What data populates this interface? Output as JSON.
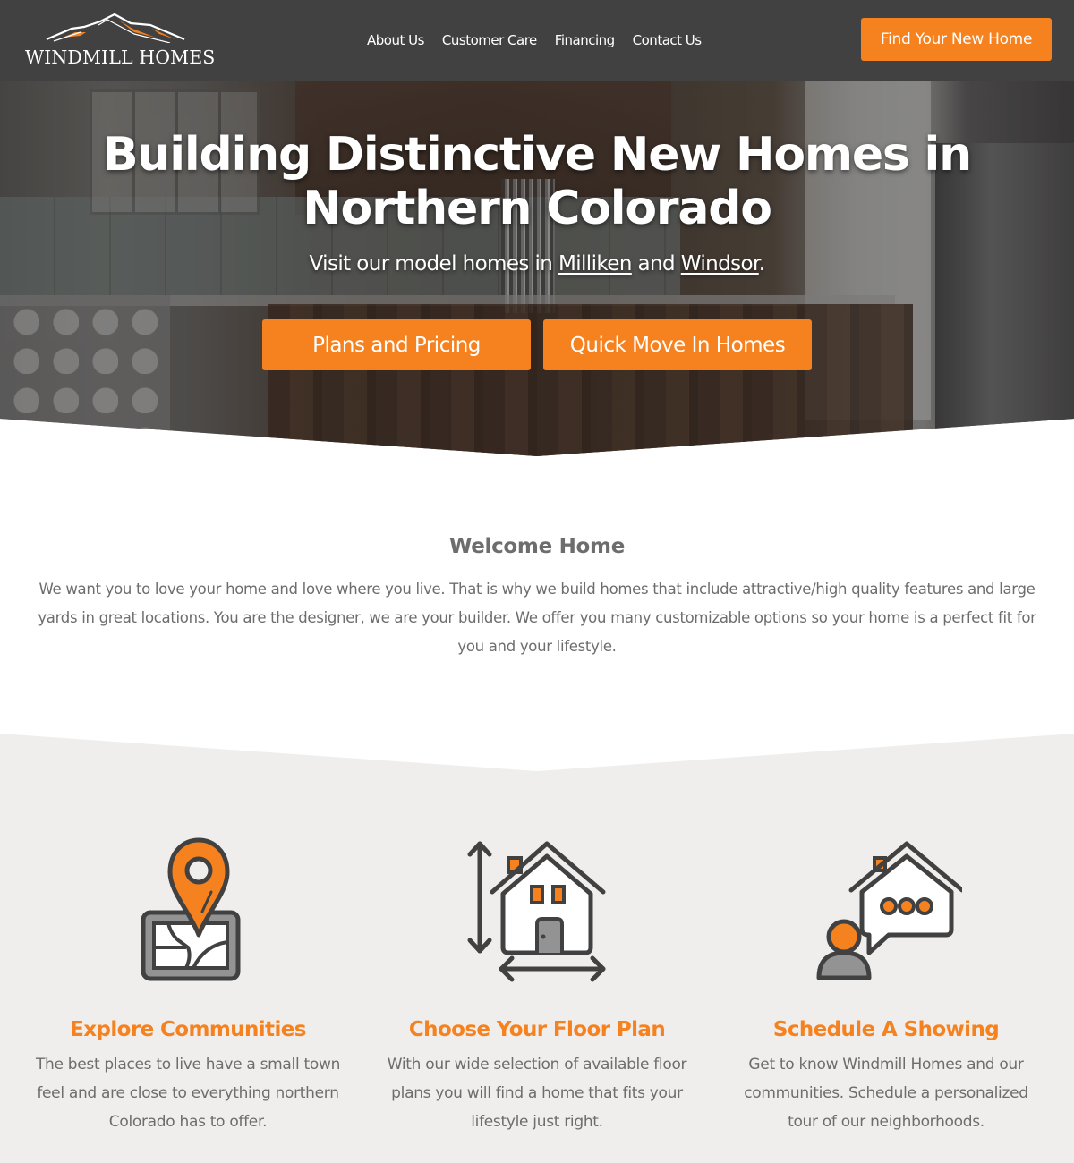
{
  "header": {
    "logo_text": "WINDMILL HOMES",
    "nav": [
      {
        "label": "About Us"
      },
      {
        "label": "Customer Care"
      },
      {
        "label": "Financing"
      },
      {
        "label": "Contact Us"
      }
    ],
    "cta_label": "Find Your New Home"
  },
  "hero": {
    "title_line1": "Building Distinctive New Homes in",
    "title_line2": "Northern Colorado",
    "subtitle_prefix": "Visit our model homes in ",
    "link_milliken": "Milliken",
    "subtitle_and": " and ",
    "link_windsor": "Windsor",
    "subtitle_suffix": ".",
    "buttons": [
      {
        "label": "Plans and Pricing"
      },
      {
        "label": "Quick Move In Homes"
      }
    ]
  },
  "welcome": {
    "title": "Welcome Home",
    "text": "We want you to love your home and love where you live. That is why we build homes that include attractive/high quality features and large yards in great locations. You are the designer, we are your builder. We offer you many customizable options so your home is a perfect fit for you and your lifestyle."
  },
  "features": [
    {
      "icon": "map-pin-icon",
      "title": "Explore Communities",
      "text": "The best places to live have a small town feel and are close to everything northern Colorado has to offer."
    },
    {
      "icon": "floor-plan-house-icon",
      "title": "Choose Your Floor Plan",
      "text": "With our wide selection of available floor plans you will find a home that fits your lifestyle just right."
    },
    {
      "icon": "schedule-showing-icon",
      "title": "Schedule A Showing",
      "text": "Get to know Windmill Homes and our communities. Schedule a personalized tour of our neighborhoods."
    }
  ],
  "colors": {
    "accent": "#f5821f",
    "header_bg": "#414142",
    "text": "#6d6d6d",
    "icon_stroke": "#414142",
    "features_bg": "#efeeed"
  }
}
